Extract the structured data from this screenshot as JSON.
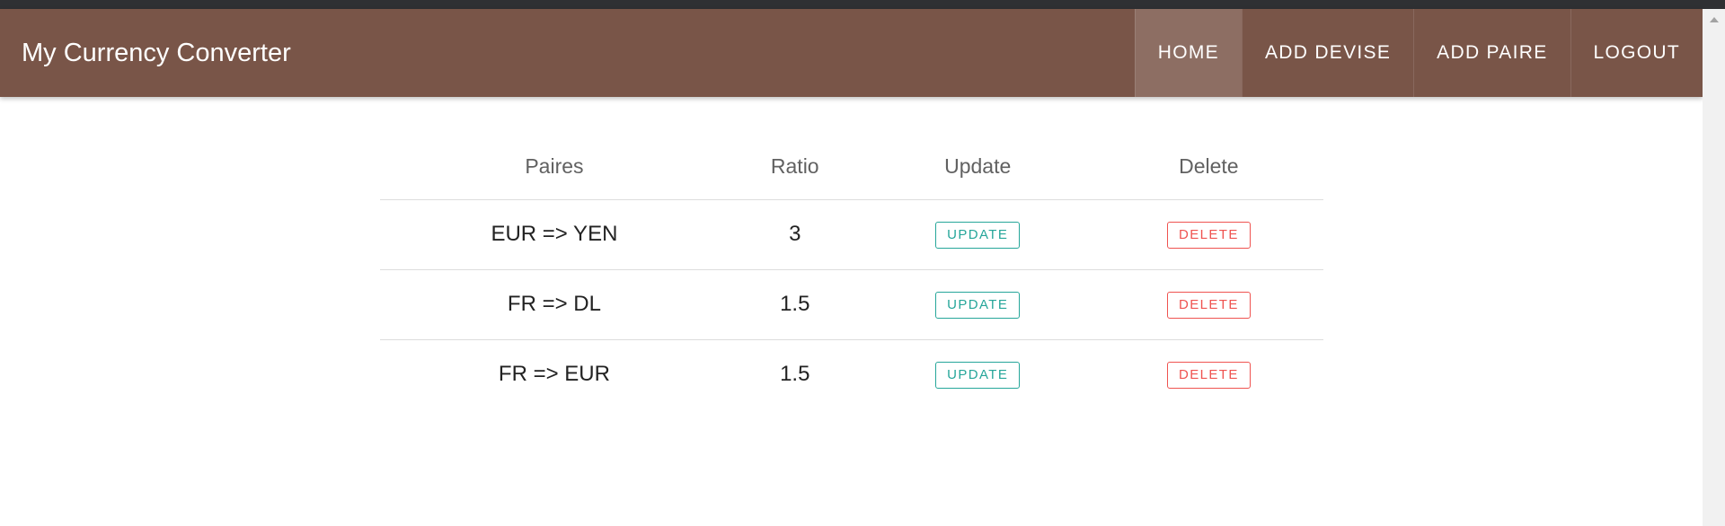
{
  "navbar": {
    "brand": "My Currency Converter",
    "links": [
      "HOME",
      "ADD DEVISE",
      "ADD PAIRE",
      "LOGOUT"
    ]
  },
  "table": {
    "headers": [
      "Paires",
      "Ratio",
      "Update",
      "Delete"
    ],
    "rows": [
      {
        "paire": "EUR => YEN",
        "ratio": "3",
        "update": "UPDATE",
        "delete": "DELETE"
      },
      {
        "paire": "FR => DL",
        "ratio": "1.5",
        "update": "UPDATE",
        "delete": "DELETE"
      },
      {
        "paire": "FR => EUR",
        "ratio": "1.5",
        "update": "UPDATE",
        "delete": "DELETE"
      }
    ]
  },
  "colors": {
    "navbar": "#795548",
    "update": "#26a69a",
    "delete": "#ef5350"
  }
}
